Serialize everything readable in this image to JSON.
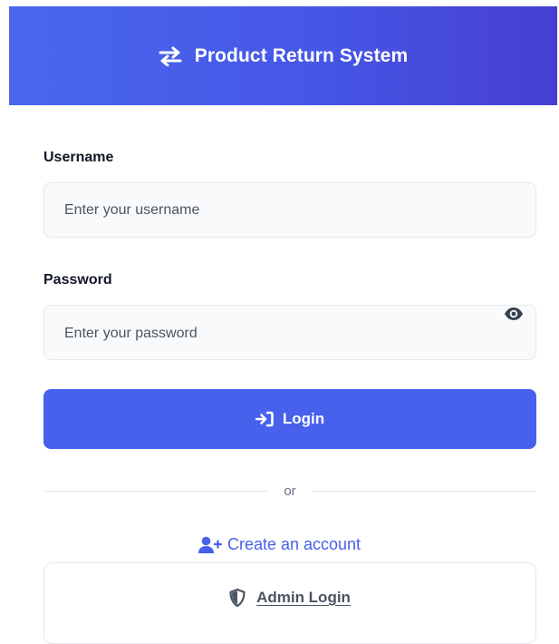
{
  "header": {
    "title": "Product Return System",
    "icon": "arrows-exchange-icon"
  },
  "form": {
    "username_label": "Username",
    "username_placeholder": "Enter your username",
    "username_value": "",
    "password_label": "Password",
    "password_placeholder": "Enter your password",
    "password_value": "",
    "password_toggle_icon": "eye-icon",
    "login_label": "Login",
    "login_icon": "sign-in-icon"
  },
  "divider": {
    "text": "or"
  },
  "links": {
    "create_account": "Create an account",
    "create_account_icon": "user-plus-icon",
    "admin_login": "Admin Login",
    "admin_login_icon": "shield-icon"
  },
  "colors": {
    "header_start": "#4a67ec",
    "header_end": "#473fd1",
    "primary": "#4861ec",
    "link": "#4860ea",
    "input_bg": "#f9fafb",
    "border": "#e5e7eb"
  }
}
